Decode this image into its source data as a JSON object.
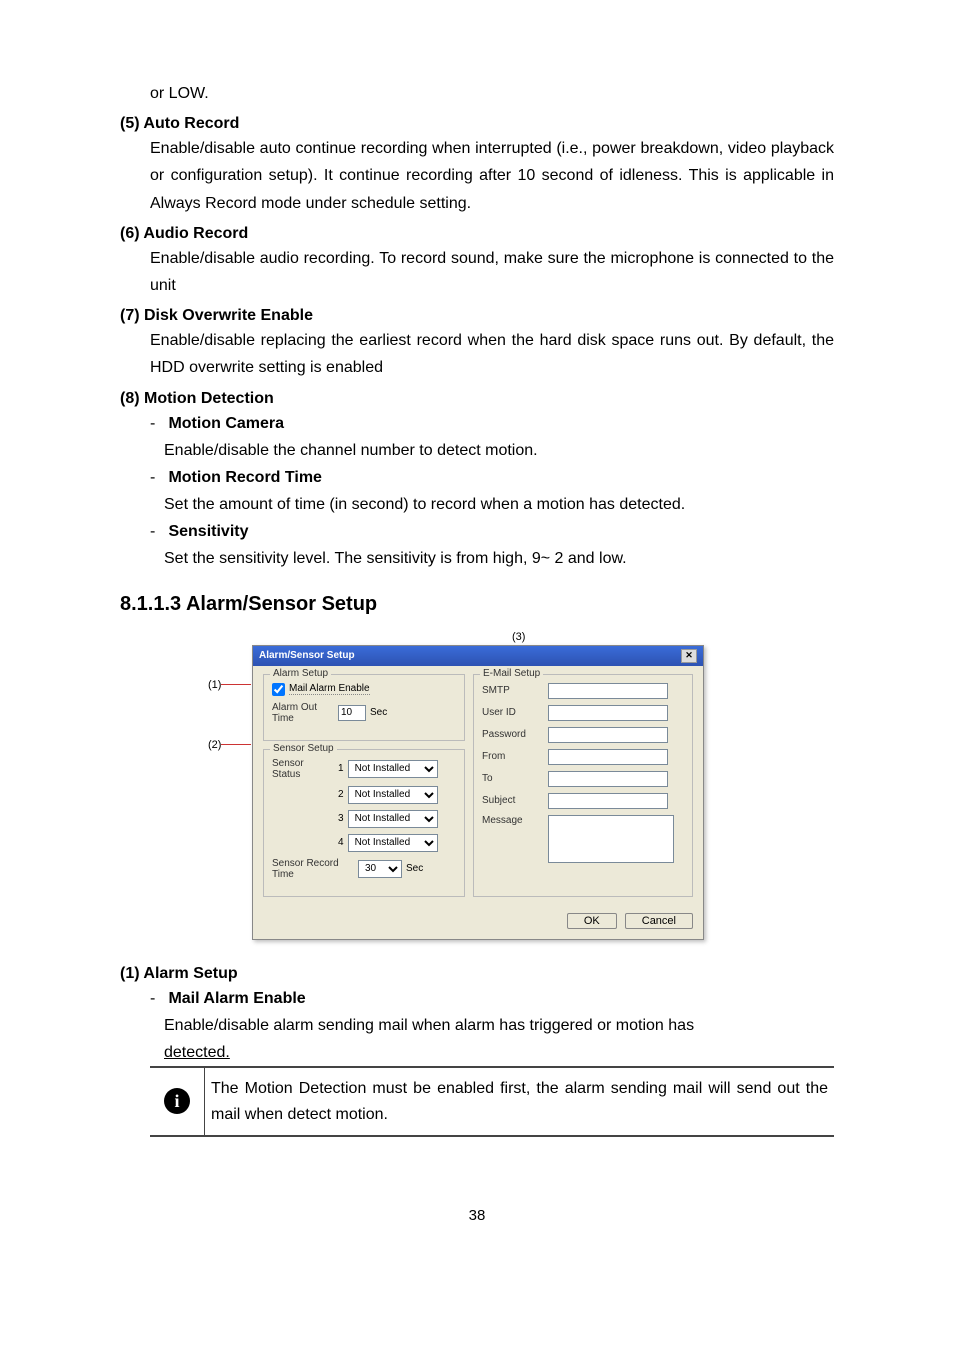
{
  "intro": {
    "text": "or LOW."
  },
  "item5": {
    "heading": "(5) Auto Record",
    "body": "Enable/disable auto continue recording when interrupted (i.e., power breakdown, video playback or configuration setup). It continue recording after 10 second of idleness. This is applicable in Always Record mode under schedule setting."
  },
  "item6": {
    "heading": "(6) Audio Record",
    "body": "Enable/disable audio recording. To record sound, make sure the microphone is connected to the unit"
  },
  "item7": {
    "heading": "(7) Disk Overwrite Enable",
    "body": "Enable/disable replacing the earliest record when the hard disk space runs out. By default, the HDD overwrite setting is enabled"
  },
  "item8": {
    "heading": "(8) Motion Detection",
    "sub_camera_h": "Motion Camera",
    "sub_camera_b": "Enable/disable the channel number to detect motion.",
    "sub_record_h": "Motion Record Time",
    "sub_record_b": "Set the amount of time (in second) to record when a motion has detected.",
    "sub_sens_h": "Sensitivity",
    "sub_sens_b": "Set the sensitivity level. The sensitivity is from high, 9~ 2 and low."
  },
  "section_heading": "8.1.1.3 Alarm/Sensor Setup",
  "callouts": {
    "c1": "(1)",
    "c2": "(2)",
    "c3": "(3)"
  },
  "dialog": {
    "title": "Alarm/Sensor Setup",
    "alarm_legend": "Alarm Setup",
    "sensor_legend": "Sensor Setup",
    "email_legend": "E-Mail Setup",
    "mail_enable": "Mail Alarm Enable",
    "alarm_out_time_lbl": "Alarm Out Time",
    "alarm_out_time_val": "10",
    "sec": "Sec",
    "sensor_status_lbl": "Sensor Status",
    "not_installed": "Not Installed",
    "sensor_record_time_lbl": "Sensor Record Time",
    "sensor_record_time_val": "30",
    "smtp": "SMTP",
    "userid": "User ID",
    "password": "Password",
    "from": "From",
    "to": "To",
    "subject": "Subject",
    "message": "Message",
    "ok": "OK",
    "cancel": "Cancel"
  },
  "item1": {
    "heading": "(1) Alarm Setup",
    "sub_h": "Mail Alarm Enable",
    "sub_b1": "Enable/disable alarm sending mail when alarm has triggered or motion has ",
    "sub_b2": "detected."
  },
  "info_box": "The Motion Detection must be enabled first, the alarm sending mail will send out the mail when detect motion.",
  "page_number": "38"
}
